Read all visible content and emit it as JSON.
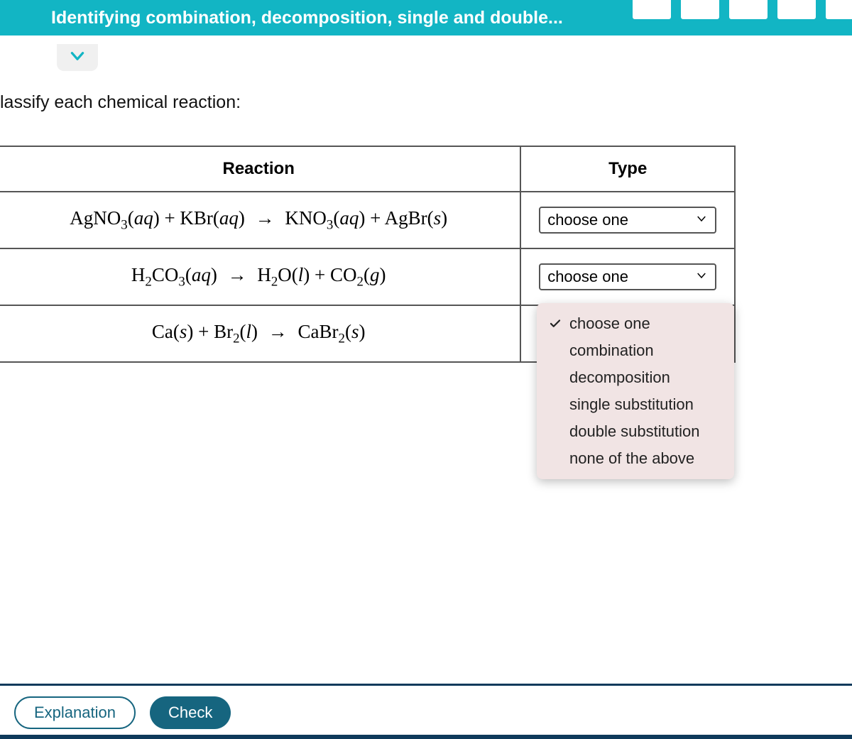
{
  "topbar": {
    "title": "Identifying combination, decomposition, single and double..."
  },
  "instruction": "lassify each chemical reaction:",
  "table": {
    "headers": {
      "reaction": "Reaction",
      "type": "Type"
    },
    "rows": [
      {
        "reaction_html": "AgNO<sub>3</sub>(<span class='state'>aq</span>) + KBr(<span class='state'>aq</span>) <span class='arrow'>→</span> KNO<sub>3</sub>(<span class='state'>aq</span>) + AgBr(<span class='state'>s</span>)",
        "select_label": "choose one"
      },
      {
        "reaction_html": "H<sub>2</sub>CO<sub>3</sub>(<span class='state'>aq</span>) <span class='arrow'>→</span> H<sub>2</sub>O(<span class='state'>l</span>) + CO<sub>2</sub>(<span class='state'>g</span>)",
        "select_label": "choose one"
      },
      {
        "reaction_html": "Ca(<span class='state'>s</span>) + Br<sub>2</sub>(<span class='state'>l</span>) <span class='arrow'>→</span> CaBr<sub>2</sub>(<span class='state'>s</span>)",
        "select_label": "choose one"
      }
    ]
  },
  "dropdown": {
    "options": [
      {
        "label": "choose one",
        "checked": true
      },
      {
        "label": "combination",
        "checked": false
      },
      {
        "label": "decomposition",
        "checked": false
      },
      {
        "label": "single substitution",
        "checked": false
      },
      {
        "label": "double substitution",
        "checked": false
      },
      {
        "label": "none of the above",
        "checked": false
      }
    ]
  },
  "footer": {
    "explanation": "Explanation",
    "check": "Check"
  }
}
